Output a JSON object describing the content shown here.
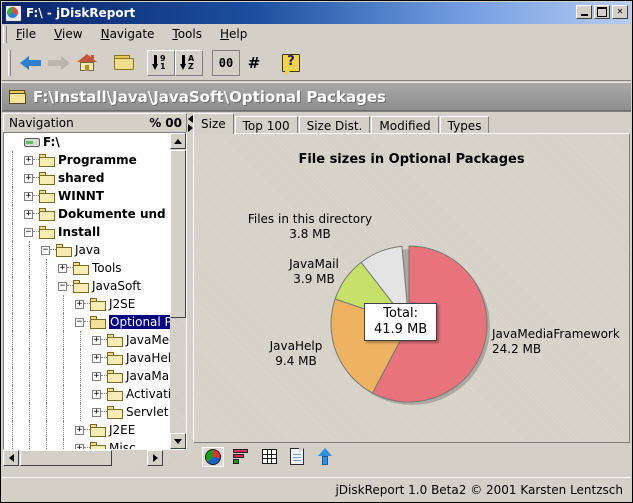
{
  "window": {
    "title": "F:\\ - jDiskReport",
    "icon": "pie-chart-icon",
    "buttons": {
      "minimize": "_",
      "maximize": "□",
      "close": "✕"
    }
  },
  "menubar": {
    "items": [
      {
        "label": "File",
        "mnemonic": "F"
      },
      {
        "label": "View",
        "mnemonic": "V"
      },
      {
        "label": "Navigate",
        "mnemonic": "N"
      },
      {
        "label": "Tools",
        "mnemonic": "T"
      },
      {
        "label": "Help",
        "mnemonic": "H"
      }
    ]
  },
  "toolbar": {
    "items": [
      {
        "name": "back-button",
        "icon": "left-arrow-icon",
        "label": ""
      },
      {
        "name": "forward-button",
        "icon": "right-arrow-icon",
        "label": ""
      },
      {
        "name": "home-button",
        "icon": "home-icon",
        "label": ""
      },
      {
        "name": "open-folder-button",
        "icon": "folder-icon",
        "label": ""
      },
      {
        "name": "sort-by-size-button",
        "icon": "sort-numeric-icon",
        "label": "9\n1"
      },
      {
        "name": "sort-by-name-button",
        "icon": "sort-alpha-icon",
        "label": "A\nZ"
      },
      {
        "name": "show-numbers-button",
        "icon": "zero-zero-icon",
        "label": "00"
      },
      {
        "name": "show-count-button",
        "icon": "hash-icon",
        "label": "#"
      },
      {
        "name": "help-button",
        "icon": "help-question-icon",
        "label": "?"
      }
    ]
  },
  "pathbar": {
    "icon": "folder-icon",
    "path": "F:\\Install\\Java\\JavaSoft\\Optional Packages"
  },
  "navigation": {
    "header_title": "Navigation",
    "header_buttons": [
      {
        "name": "percent-toggle",
        "label": "%"
      },
      {
        "name": "numbers-toggle",
        "label": "00"
      }
    ],
    "tree": [
      {
        "label": "F:\\",
        "depth": 0,
        "icon": "drive-icon",
        "node": "none",
        "bold": true,
        "selected": false
      },
      {
        "label": "Programme",
        "depth": 1,
        "icon": "folder-icon",
        "node": "plus",
        "bold": true,
        "selected": false
      },
      {
        "label": "shared",
        "depth": 1,
        "icon": "folder-icon",
        "node": "plus",
        "bold": true,
        "selected": false
      },
      {
        "label": "WINNT",
        "depth": 1,
        "icon": "folder-icon",
        "node": "plus",
        "bold": true,
        "selected": false
      },
      {
        "label": "Dokumente und Ein",
        "depth": 1,
        "icon": "folder-icon",
        "node": "plus",
        "bold": true,
        "selected": false
      },
      {
        "label": "Install",
        "depth": 1,
        "icon": "folder-icon",
        "node": "minus",
        "bold": true,
        "selected": false
      },
      {
        "label": "Java",
        "depth": 2,
        "icon": "folder-icon",
        "node": "minus",
        "bold": false,
        "selected": false
      },
      {
        "label": "Tools",
        "depth": 3,
        "icon": "folder-icon",
        "node": "plus",
        "bold": false,
        "selected": false
      },
      {
        "label": "JavaSoft",
        "depth": 3,
        "icon": "folder-icon",
        "node": "minus",
        "bold": false,
        "selected": false
      },
      {
        "label": "J2SE",
        "depth": 4,
        "icon": "folder-icon",
        "node": "plus",
        "bold": false,
        "selected": false
      },
      {
        "label": "Optional Pa",
        "depth": 4,
        "icon": "folder-open-icon",
        "node": "minus",
        "bold": false,
        "selected": true
      },
      {
        "label": "JavaMed",
        "depth": 5,
        "icon": "folder-icon",
        "node": "plus",
        "bold": false,
        "selected": false
      },
      {
        "label": "JavaHelp",
        "depth": 5,
        "icon": "folder-icon",
        "node": "plus",
        "bold": false,
        "selected": false
      },
      {
        "label": "JavaMail",
        "depth": 5,
        "icon": "folder-icon",
        "node": "plus",
        "bold": false,
        "selected": false
      },
      {
        "label": "Activatio",
        "depth": 5,
        "icon": "folder-icon",
        "node": "plus",
        "bold": false,
        "selected": false
      },
      {
        "label": "Servlet",
        "depth": 5,
        "icon": "folder-icon",
        "node": "plus",
        "bold": false,
        "selected": false
      },
      {
        "label": "J2EE",
        "depth": 4,
        "icon": "folder-icon",
        "node": "plus",
        "bold": false,
        "selected": false
      },
      {
        "label": "Misc",
        "depth": 4,
        "icon": "folder-icon",
        "node": "plus",
        "bold": false,
        "selected": false
      }
    ]
  },
  "tabs": [
    {
      "label": "Size",
      "active": true
    },
    {
      "label": "Top 100",
      "active": false
    },
    {
      "label": "Size Dist.",
      "active": false
    },
    {
      "label": "Modified",
      "active": false
    },
    {
      "label": "Types",
      "active": false
    }
  ],
  "chart_data": {
    "type": "pie",
    "title": "File sizes in Optional Packages",
    "unit": "MB",
    "total_label": "Total:",
    "total_value": "41.9 MB",
    "legend_position": "callout-labels",
    "categories": [
      "JavaMediaFramework",
      "JavaHelp",
      "JavaMail",
      "Files in this directory"
    ],
    "values": [
      24.2,
      9.4,
      3.9,
      3.8
    ],
    "value_labels": [
      "24.2 MB",
      "9.4 MB",
      "3.9 MB",
      "3.8 MB"
    ],
    "colors": [
      "#e8737c",
      "#eeb263",
      "#c6e06a",
      "#e4e4e4"
    ],
    "slices": [
      {
        "name": "JavaMediaFramework",
        "value": 24.2,
        "label": "24.2 MB",
        "color": "#e8737c",
        "start_deg": 0,
        "sweep_deg": 207.9
      },
      {
        "name": "JavaHelp",
        "value": 9.4,
        "label": "9.4 MB",
        "color": "#eeb263",
        "start_deg": 207.9,
        "sweep_deg": 80.8
      },
      {
        "name": "JavaMail",
        "value": 3.9,
        "label": "3.9 MB",
        "color": "#c6e06a",
        "start_deg": 288.7,
        "sweep_deg": 33.5
      },
      {
        "name": "Files in this directory",
        "value": 3.8,
        "label": "3.8 MB",
        "color": "#e4e4e4",
        "start_deg": 322.2,
        "sweep_deg": 32.6
      }
    ]
  },
  "viewbar": {
    "items": [
      {
        "name": "pie-chart-view-button",
        "icon": "pie-chart-icon",
        "selected": true
      },
      {
        "name": "bar-chart-view-button",
        "icon": "bar-chart-icon",
        "selected": false
      },
      {
        "name": "table-view-button",
        "icon": "grid-table-icon",
        "selected": false
      },
      {
        "name": "details-view-button",
        "icon": "document-icon",
        "selected": false
      },
      {
        "name": "parent-folder-button",
        "icon": "up-arrow-icon",
        "selected": false
      }
    ]
  },
  "statusbar": {
    "text": "jDiskReport 1.0 Beta2  © 2001 Karsten Lentzsch"
  }
}
